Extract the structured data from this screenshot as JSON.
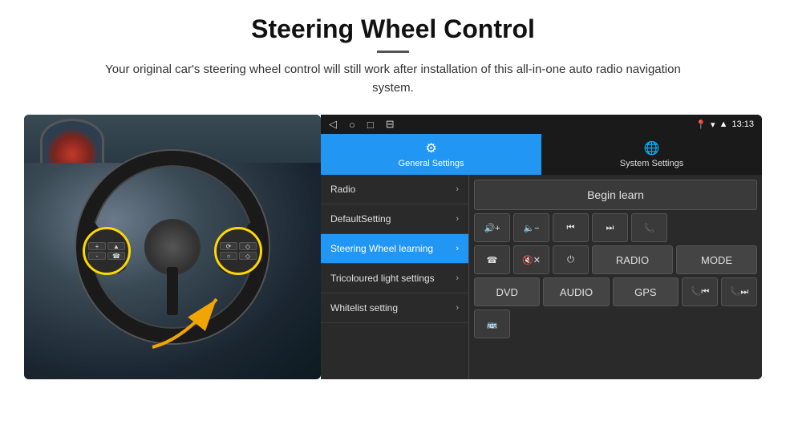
{
  "header": {
    "title": "Steering Wheel Control",
    "divider": true,
    "subtitle": "Your original car's steering wheel control will still work after installation of this all-in-one auto radio navigation system."
  },
  "status_bar": {
    "time": "13:13",
    "nav_icons": [
      "◁",
      "○",
      "□",
      "⊟"
    ]
  },
  "tabs": [
    {
      "id": "general",
      "label": "General Settings",
      "icon": "⚙",
      "active": true
    },
    {
      "id": "system",
      "label": "System Settings",
      "icon": "🌐",
      "active": false
    }
  ],
  "menu": {
    "items": [
      {
        "label": "Radio",
        "active": false
      },
      {
        "label": "DefaultSetting",
        "active": false
      },
      {
        "label": "Steering Wheel learning",
        "active": true
      },
      {
        "label": "Tricoloured light settings",
        "active": false
      },
      {
        "label": "Whitelist setting",
        "active": false
      }
    ]
  },
  "control_panel": {
    "begin_learn_label": "Begin learn",
    "buttons_row1": [
      {
        "label": "🔊+",
        "icon": "vol-up"
      },
      {
        "label": "🔈-",
        "icon": "vol-down"
      },
      {
        "label": "⏮",
        "icon": "prev-track"
      },
      {
        "label": "⏭",
        "icon": "next-track"
      },
      {
        "label": "📞",
        "icon": "phone"
      }
    ],
    "buttons_row2": [
      {
        "label": "☎",
        "icon": "hang-up"
      },
      {
        "label": "🔇x",
        "icon": "mute"
      },
      {
        "label": "⏻",
        "icon": "power"
      },
      {
        "label": "RADIO",
        "icon": "radio"
      },
      {
        "label": "MODE",
        "icon": "mode"
      }
    ],
    "buttons_row3": [
      {
        "label": "DVD",
        "icon": "dvd"
      },
      {
        "label": "AUDIO",
        "icon": "audio"
      },
      {
        "label": "GPS",
        "icon": "gps"
      },
      {
        "label": "📞⏮",
        "icon": "phone-prev"
      },
      {
        "label": "📞⏭",
        "icon": "phone-next"
      }
    ],
    "buttons_row4": [
      {
        "label": "🚌",
        "icon": "bus"
      }
    ]
  }
}
